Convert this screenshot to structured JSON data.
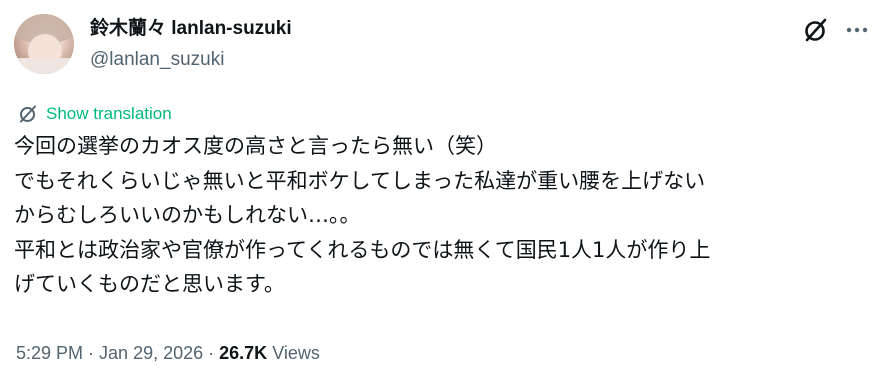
{
  "author": {
    "display_name": "鈴木蘭々 lanlan-suzuki",
    "handle": "@lanlan_suzuki"
  },
  "icons": {
    "grok": "grok-icon",
    "more": "more-icon",
    "translate": "translate-icon"
  },
  "translate": {
    "label": "Show translation"
  },
  "tweet": {
    "lines": [
      "今回の選挙のカオス度の高さと言ったら無い（笑）",
      "でもそれくらいじゃ無いと平和ボケしてしまった私達が重い腰を上げない",
      "からむしろいいのかもしれない…。。",
      "平和とは政治家や官僚が作ってくれるものでは無くて国民1人1人が作り上",
      "げていくものだと思います。"
    ]
  },
  "meta": {
    "time": "5:29 PM",
    "date": "Jan 29, 2026",
    "separator": " · ",
    "views_count": "26.7K",
    "views_label": "Views"
  },
  "colors": {
    "text": "#0f1419",
    "secondary": "#536471",
    "translate_green": "#00ba7c"
  }
}
